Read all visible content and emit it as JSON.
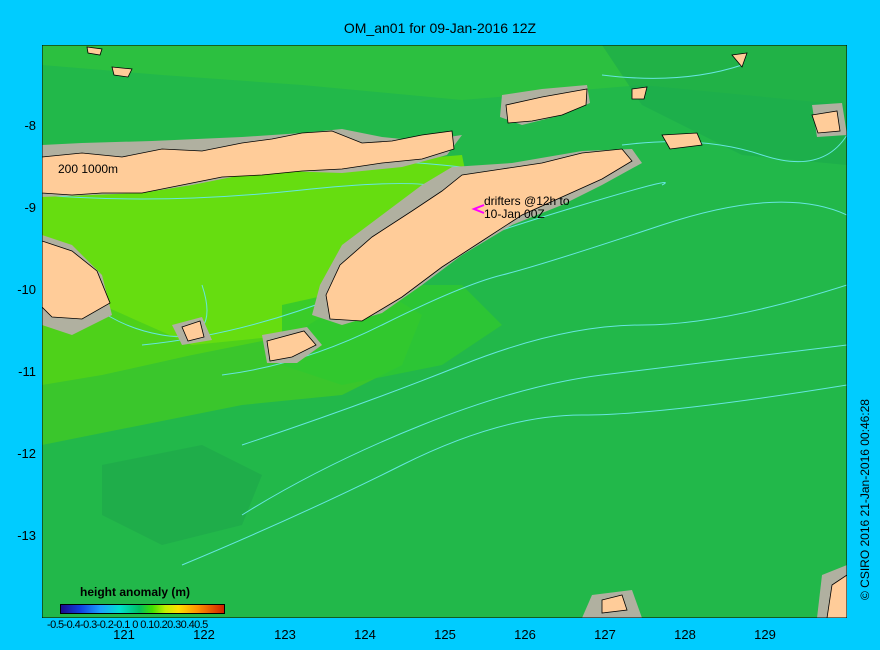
{
  "title": "OM_an01 for 09-Jan-2016 12Z",
  "y_axis": [
    "-8",
    "-9",
    "-10",
    "-11",
    "-12",
    "-13"
  ],
  "x_axis": [
    "121",
    "122",
    "123",
    "124",
    "125",
    "126",
    "127",
    "128",
    "129"
  ],
  "colorbar": {
    "title": "height anomaly (m)",
    "ticks": "-0.5-0.4-0.3-0.2-0.1 0 0.10.20.30.40.5",
    "colors": [
      "#1a0a8c",
      "#1040e0",
      "#1aa0ff",
      "#00e0d0",
      "#00c060",
      "#40e000",
      "#c0f000",
      "#ffe000",
      "#ff9000",
      "#d02000"
    ]
  },
  "isobath_label": "200  1000m",
  "drifters_label_line1": "drifters @12h to",
  "drifters_label_line2": "10-Jan 00Z",
  "copyright": "© CSIRO 2016   21-Jan-2016 00:46:28",
  "colors": {
    "background": "#00ccff",
    "land": "#ffcc99",
    "shelf": "#b0b0a0",
    "ocean_base": "#22bb44",
    "contour": "#60e0e0",
    "drifter": "#ff00ff"
  }
}
